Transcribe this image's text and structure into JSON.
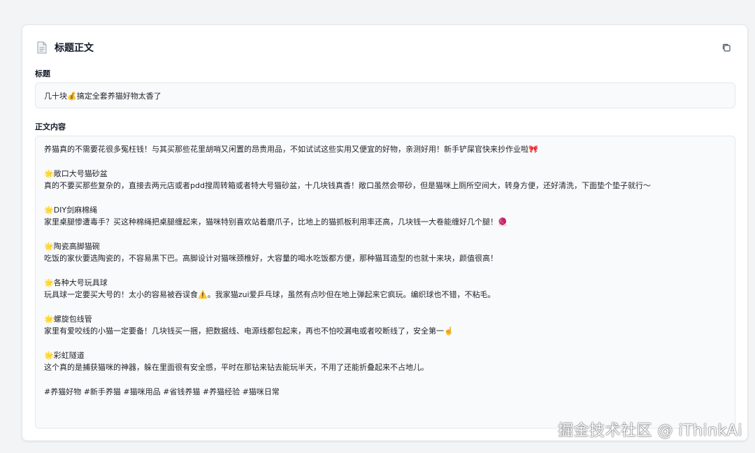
{
  "card": {
    "title": "标题正文",
    "icons": {
      "doc": "document-icon",
      "copy": "copy-icon"
    }
  },
  "fields": {
    "title_label": "标题",
    "title_value": "几十块💰搞定全套养猫好物太香了",
    "body_label": "正文内容"
  },
  "body": {
    "intro": "养猫真的不需要花很多冤枉钱！与其买那些花里胡哨又闲置的昂贵用品，不如试试这些实用又便宜的好物，亲测好用！新手铲屎官快来抄作业啦🎀",
    "sections": [
      {
        "heading": "🌟敞口大号猫砂盆",
        "text": "真的不要买那些复杂的，直接去两元店或者pdd搜周转箱或者特大号猫砂盆，十几块钱真香！敞口虽然会带砂，但是猫咪上厕所空间大，转身方便，还好清洗，下面垫个垫子就行～"
      },
      {
        "heading": "🌟DIY剑麻棉绳",
        "text": "家里桌腿惨遭毒手？买这种棉绳把桌腿缠起来，猫咪特别喜欢站着磨爪子，比地上的猫抓板利用率还高，几块钱一大卷能缠好几个腿！🧶"
      },
      {
        "heading": "🌟陶瓷高脚猫碗",
        "text": "吃饭的家伙要选陶瓷的，不容易黑下巴。高脚设计对猫咪颈椎好，大容量的喝水吃饭都方便，那种猫耳造型的也就十来块，颜值很高！"
      },
      {
        "heading": "🌟各种大号玩具球",
        "text": "玩具球一定要买大号的！太小的容易被吞误食⚠️。我家猫zui爱乒乓球，虽然有点吵但在地上弹起来它疯玩。编织球也不错，不粘毛。"
      },
      {
        "heading": "🌟螺旋包线管",
        "text": "家里有爱咬线的小猫一定要备！几块钱买一捆，把数据线、电源线都包起来，再也不怕咬漏电或者咬断线了，安全第一☝️"
      },
      {
        "heading": "🌟彩虹隧道",
        "text": "这个真的是捕获猫咪的神器，躲在里面很有安全感，平时在那钻来钻去能玩半天，不用了还能折叠起来不占地儿。"
      }
    ],
    "tags": "#养猫好物 #新手养猫 #猫咪用品 #省钱养猫 #养猫经验 #猫咪日常"
  },
  "watermark": "掘金技术社区 @ iThinkAi"
}
